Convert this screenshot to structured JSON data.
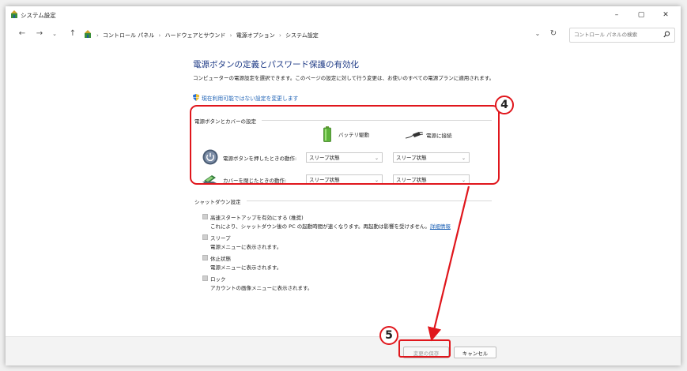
{
  "window": {
    "title": "システム設定",
    "controls": {
      "minimize": "–",
      "maximize": "▢",
      "close": "✕"
    }
  },
  "navbar": {
    "breadcrumbs": [
      "コントロール パネル",
      "ハードウェアとサウンド",
      "電源オプション",
      "システム設定"
    ],
    "crumb_sep": "›",
    "search_placeholder": "コントロール パネルの検索"
  },
  "page": {
    "title": "電源ボタンの定義とパスワード保護の有効化",
    "description": "コンピューターの電源設定を選択できます。このページの設定に対して行う変更は、お使いのすべての電源プランに適用されます。",
    "admin_link": "現在利用可能ではない設定を変更します"
  },
  "power_section": {
    "heading": "電源ボタンとカバーの設定",
    "col_battery": "バッテリ駆動",
    "col_plugged": "電源に接続",
    "rows": [
      {
        "label": "電源ボタンを押したときの動作:",
        "battery": "スリープ状態",
        "plugged": "スリープ状態"
      },
      {
        "label": "カバーを閉じたときの動作:",
        "battery": "スリープ状態",
        "plugged": "スリープ状態"
      }
    ]
  },
  "shutdown_section": {
    "heading": "シャットダウン設定",
    "items": [
      {
        "title": "高速スタートアップを有効にする (推奨)",
        "desc": "これにより、シャットダウン後の PC の起動時間が速くなります。再起動は影響を受けません。",
        "link": "詳細情報"
      },
      {
        "title": "スリープ",
        "desc": "電源メニューに表示されます。"
      },
      {
        "title": "休止状態",
        "desc": "電源メニューに表示されます。"
      },
      {
        "title": "ロック",
        "desc": "アカウントの画像メニューに表示されます。"
      }
    ]
  },
  "footer": {
    "save_label": "変更の保存",
    "cancel_label": "キャンセル"
  },
  "annotations": {
    "step4": "4",
    "step5": "5",
    "color": "#e0161c"
  }
}
